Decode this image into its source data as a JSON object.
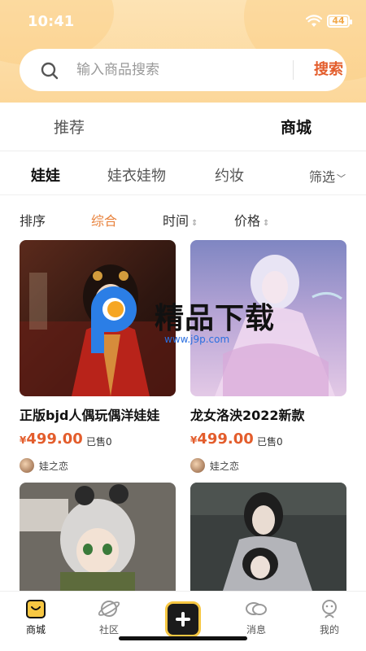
{
  "status": {
    "time": "10:41",
    "battery": "44"
  },
  "search": {
    "placeholder": "输入商品搜索",
    "button": "搜索"
  },
  "top_tabs": [
    {
      "label": "推荐",
      "active": false
    },
    {
      "label": "商城",
      "active": true
    }
  ],
  "category_tabs": [
    {
      "label": "娃娃",
      "active": true
    },
    {
      "label": "娃衣娃物",
      "active": false
    },
    {
      "label": "约妆",
      "active": false
    }
  ],
  "filter": {
    "label": "筛选"
  },
  "sort": [
    {
      "label": "排序"
    },
    {
      "label": "综合",
      "active": true
    },
    {
      "label": "时间"
    },
    {
      "label": "价格"
    }
  ],
  "products": [
    {
      "title": "正版bjd人偶玩偶洋娃娃",
      "currency": "¥",
      "price": "499.00",
      "sold": "已售0",
      "shop": "娃之恋"
    },
    {
      "title": "龙女洛泱2022新款",
      "currency": "¥",
      "price": "499.00",
      "sold": "已售0",
      "shop": "娃之恋"
    },
    {
      "title": "",
      "currency": "",
      "price": "",
      "sold": "",
      "shop": ""
    },
    {
      "title": "",
      "currency": "",
      "price": "",
      "sold": "",
      "shop": ""
    }
  ],
  "watermark": {
    "text": "精品下载",
    "url": "www.j9p.com"
  },
  "bottom_nav": [
    {
      "label": "商城",
      "icon": "shop-bag-icon",
      "active": true
    },
    {
      "label": "社区",
      "icon": "planet-icon"
    },
    {
      "label": "",
      "icon": "plus-icon"
    },
    {
      "label": "消息",
      "icon": "chat-bubble-icon"
    },
    {
      "label": "我的",
      "icon": "profile-icon"
    }
  ],
  "colors": {
    "accent_yellow": "#f7c742",
    "price_red": "#e35d2c",
    "sort_active": "#e8823c",
    "header_bg": "#fcd79a"
  }
}
